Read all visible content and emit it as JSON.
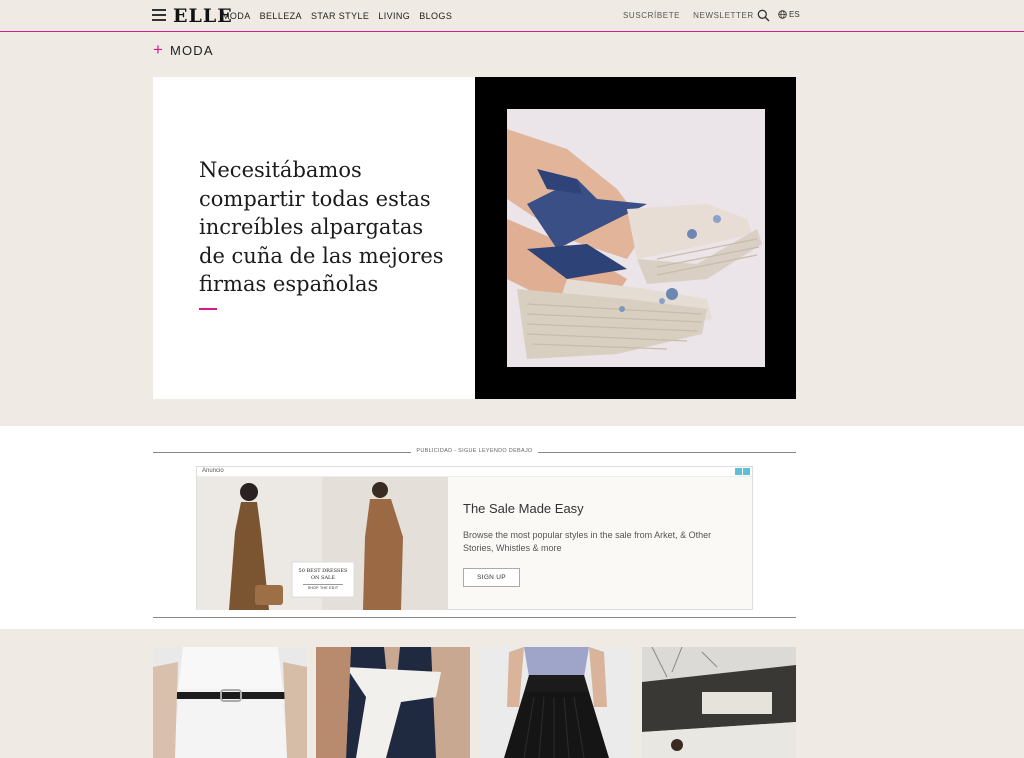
{
  "header": {
    "logo": "ELLE",
    "nav": [
      "MODA",
      "BELLEZA",
      "STAR STYLE",
      "LIVING",
      "BLOGS"
    ],
    "subscribe": "SUSCRÍBETE",
    "newsletter": "NEWSLETTER",
    "lang": "ES",
    "accent_color": "#d61a8c"
  },
  "section": {
    "label": "MODA"
  },
  "hero": {
    "title": "Necesitábamos compartir todas estas increíbles alpargatas de cuña de las mejores firmas españolas"
  },
  "ad": {
    "label": "PUBLICIDAD - SIGUE LEYENDO DEBAJO",
    "anuncio": "Anuncio",
    "title": "The Sale Made Easy",
    "description": "Browse the most popular styles in the sale from Arket, & Other Stories, Whistles & more",
    "cta": "SIGN UP",
    "badge_line1": "50 BEST DRESSES",
    "badge_line2": "ON SALE",
    "badge_link": "SHOP THE EDIT"
  }
}
